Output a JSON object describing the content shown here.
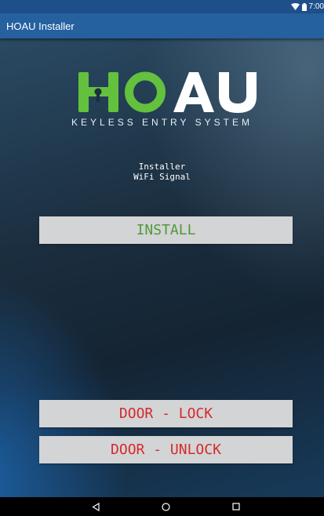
{
  "status_bar": {
    "time": "7:00",
    "icons": [
      "wifi-icon",
      "battery-icon"
    ]
  },
  "app_bar": {
    "title": "HOAU Installer"
  },
  "logo": {
    "text": "HOAU",
    "tagline": "KEYLESS ENTRY SYSTEM",
    "colors": {
      "green": "#63c13e",
      "white": "#ffffff"
    }
  },
  "info": {
    "line1": "Installer",
    "line2": "WiFi Signal"
  },
  "buttons": {
    "install": "INSTALL",
    "door_lock": "DOOR - LOCK",
    "door_unlock": "DOOR - UNLOCK"
  },
  "colors": {
    "status_bar": "#1e4f8a",
    "app_bar": "#25609f",
    "button_bg": "#d3d4d6",
    "install_text": "#4f9a3a",
    "door_text": "#d52a2a"
  },
  "nav_bar": {
    "icons": [
      "back-icon",
      "home-icon",
      "recent-apps-icon"
    ]
  }
}
